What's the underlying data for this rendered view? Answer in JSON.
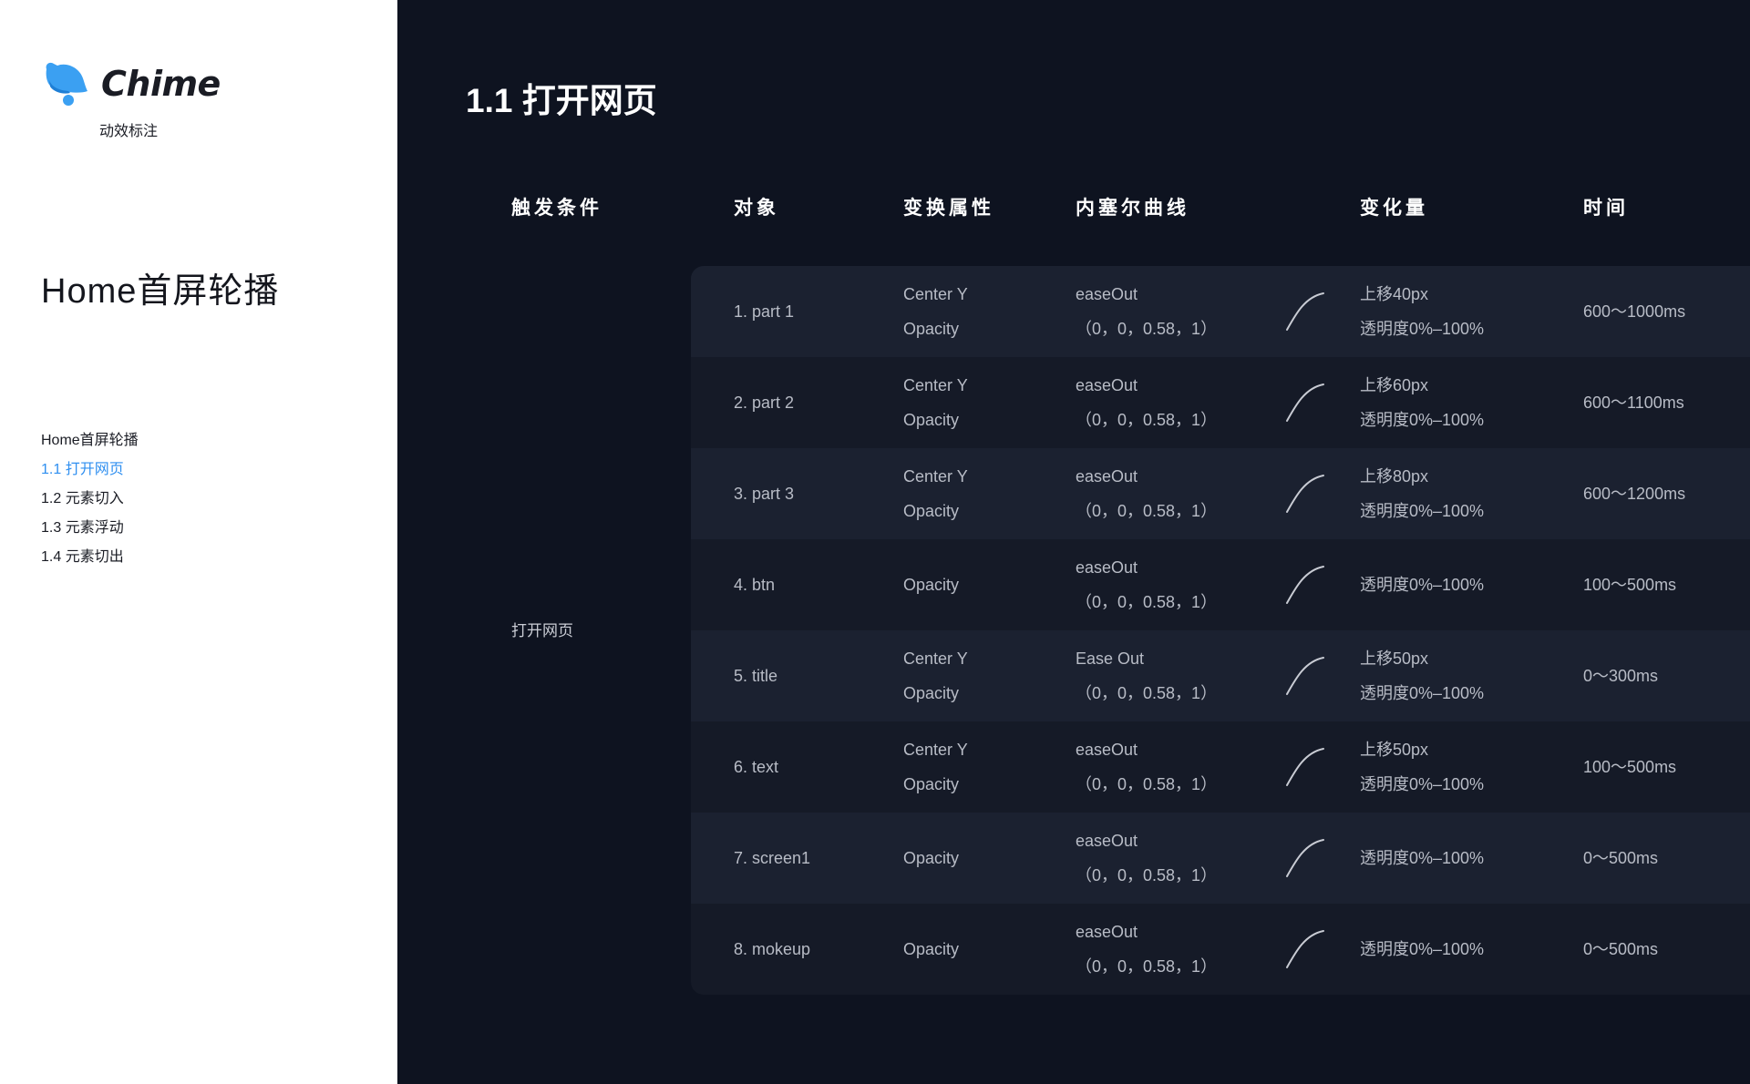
{
  "sidebar": {
    "brand": "Chime",
    "brand_sub": "动效标注",
    "page_title": "Home首屏轮播",
    "toc": [
      {
        "label": "Home首屏轮播",
        "active": false
      },
      {
        "label": "1.1 打开网页",
        "active": true
      },
      {
        "label": "1.2 元素切入",
        "active": false
      },
      {
        "label": "1.3 元素浮动",
        "active": false
      },
      {
        "label": "1.4 元素切出",
        "active": false
      }
    ]
  },
  "colors": {
    "accent": "#2f8ff0",
    "logo": "#3ba0f2",
    "main_bg": "#0e1320",
    "row_odd": "#1b2130",
    "row_even": "#151a27"
  },
  "main": {
    "section_title": "1.1 打开网页",
    "headers": {
      "trigger": "触发条件",
      "object": "对象",
      "property": "变换属性",
      "curve": "内塞尔曲线",
      "change": "变化量",
      "time": "时间"
    },
    "trigger_value": "打开网页",
    "rows": [
      {
        "object": "1. part 1",
        "prop1": "Center Y",
        "prop2": "Opacity",
        "curve1": "easeOut",
        "curve2": "（0，0，0.58，1）",
        "change1": "上移40px",
        "change2": "透明度0%–100%",
        "time": "600～1000ms"
      },
      {
        "object": "2. part 2",
        "prop1": "Center Y",
        "prop2": "Opacity",
        "curve1": "easeOut",
        "curve2": "（0，0，0.58，1）",
        "change1": "上移60px",
        "change2": "透明度0%–100%",
        "time": "600～1100ms"
      },
      {
        "object": "3. part 3",
        "prop1": "Center Y",
        "prop2": "Opacity",
        "curve1": "easeOut",
        "curve2": "（0，0，0.58，1）",
        "change1": "上移80px",
        "change2": "透明度0%–100%",
        "time": "600～1200ms"
      },
      {
        "object": "4. btn",
        "prop1": "",
        "prop2": "Opacity",
        "curve1": "easeOut",
        "curve2": "（0，0，0.58，1）",
        "change1": "",
        "change2": "透明度0%–100%",
        "time": "100～500ms"
      },
      {
        "object": "5. title",
        "prop1": "Center Y",
        "prop2": "Opacity",
        "curve1": "Ease Out",
        "curve2": "（0，0，0.58，1）",
        "change1": "上移50px",
        "change2": "透明度0%–100%",
        "time": "0～300ms"
      },
      {
        "object": "6. text",
        "prop1": "Center Y",
        "prop2": "Opacity",
        "curve1": "easeOut",
        "curve2": "（0，0，0.58，1）",
        "change1": "上移50px",
        "change2": "透明度0%–100%",
        "time": "100～500ms"
      },
      {
        "object": "7. screen1",
        "prop1": "",
        "prop2": "Opacity",
        "curve1": "easeOut",
        "curve2": "（0，0，0.58，1）",
        "change1": "",
        "change2": "透明度0%–100%",
        "time": "0～500ms"
      },
      {
        "object": "8. mokeup",
        "prop1": "",
        "prop2": "Opacity",
        "curve1": "easeOut",
        "curve2": "（0，0，0.58，1）",
        "change1": "",
        "change2": "透明度0%–100%",
        "time": "0～500ms"
      }
    ]
  }
}
